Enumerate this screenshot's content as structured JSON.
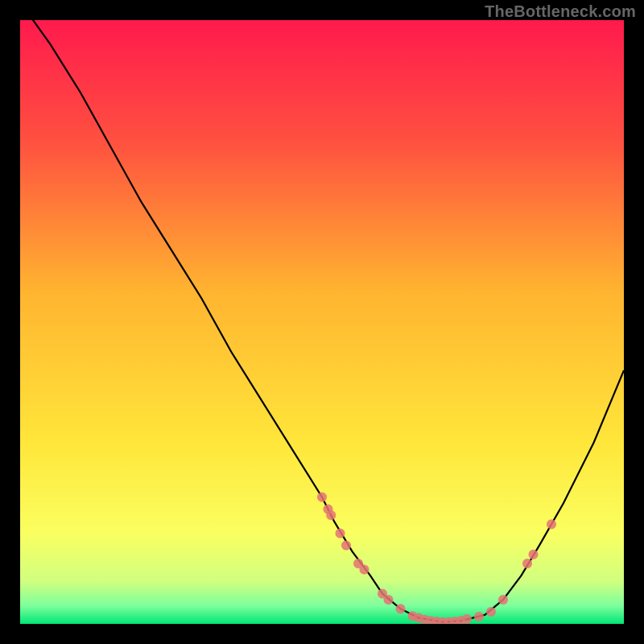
{
  "watermark": "TheBottleneck.com",
  "chart_data": {
    "type": "line",
    "title": "",
    "xlabel": "",
    "ylabel": "",
    "xlim": [
      0,
      100
    ],
    "ylim": [
      0,
      100
    ],
    "grid": false,
    "legend": false,
    "background_gradient": {
      "stops": [
        {
          "offset": 0.0,
          "color": "#ff1a4d"
        },
        {
          "offset": 0.2,
          "color": "#ff5040"
        },
        {
          "offset": 0.45,
          "color": "#ffb430"
        },
        {
          "offset": 0.7,
          "color": "#ffe63a"
        },
        {
          "offset": 0.85,
          "color": "#faff60"
        },
        {
          "offset": 0.93,
          "color": "#d0ff80"
        },
        {
          "offset": 0.97,
          "color": "#7dff9c"
        },
        {
          "offset": 1.0,
          "color": "#00e676"
        }
      ]
    },
    "series": [
      {
        "name": "bottleneck-curve",
        "color": "#000000",
        "x": [
          0,
          5,
          10,
          15,
          20,
          25,
          30,
          35,
          40,
          45,
          50,
          52,
          55,
          58,
          60,
          63,
          66,
          70,
          73,
          77,
          80,
          83,
          86,
          90,
          95,
          100
        ],
        "y": [
          103,
          96,
          88,
          79,
          70,
          62,
          54,
          45,
          37,
          29,
          21,
          17,
          12,
          8,
          5,
          2.5,
          1,
          0.3,
          0.5,
          1.5,
          4,
          8,
          13,
          20,
          30,
          42
        ]
      }
    ],
    "scatter": [
      {
        "name": "curve-markers",
        "color": "#e57373",
        "points": [
          {
            "x": 50,
            "y": 21
          },
          {
            "x": 51,
            "y": 19
          },
          {
            "x": 51.5,
            "y": 18
          },
          {
            "x": 53,
            "y": 15
          },
          {
            "x": 54,
            "y": 13
          },
          {
            "x": 56,
            "y": 10
          },
          {
            "x": 57,
            "y": 9
          },
          {
            "x": 60,
            "y": 5
          },
          {
            "x": 61,
            "y": 4
          },
          {
            "x": 63,
            "y": 2.5
          },
          {
            "x": 65,
            "y": 1.3
          },
          {
            "x": 66,
            "y": 1
          },
          {
            "x": 67,
            "y": 0.7
          },
          {
            "x": 68,
            "y": 0.5
          },
          {
            "x": 69,
            "y": 0.4
          },
          {
            "x": 70,
            "y": 0.3
          },
          {
            "x": 71,
            "y": 0.3
          },
          {
            "x": 72,
            "y": 0.4
          },
          {
            "x": 73,
            "y": 0.5
          },
          {
            "x": 74,
            "y": 0.8
          },
          {
            "x": 76,
            "y": 1.2
          },
          {
            "x": 78,
            "y": 2
          },
          {
            "x": 80,
            "y": 4
          },
          {
            "x": 84,
            "y": 10
          },
          {
            "x": 85,
            "y": 11.5
          },
          {
            "x": 88,
            "y": 16.5
          }
        ]
      }
    ]
  }
}
